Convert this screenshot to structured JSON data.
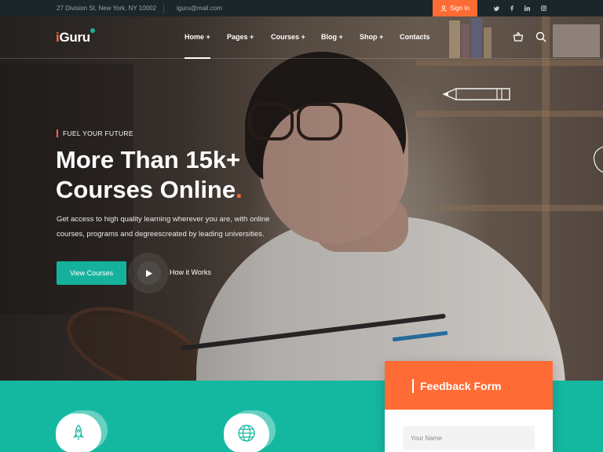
{
  "topbar": {
    "address": "27 Division St, New York, NY 10002",
    "email": "iguru@mail.com",
    "signin_label": "Sign In",
    "social": [
      "twitter-icon",
      "facebook-icon",
      "linkedin-icon",
      "instagram-icon"
    ]
  },
  "brand": {
    "logo_prefix": "i",
    "logo_rest": "Guru",
    "accent": "#ff6b35",
    "teal": "#14b8a0"
  },
  "nav": {
    "items": [
      "Home +",
      "Pages +",
      "Courses +",
      "Blog +",
      "Shop +",
      "Contacts"
    ],
    "active": "Home +",
    "icons": [
      "basket-icon",
      "search-icon"
    ]
  },
  "hero": {
    "eyebrow": "FUEL YOUR FUTURE",
    "headline_line1": "More Than 15k+",
    "headline_line2": "Courses Online",
    "headline_dot": ".",
    "subtext_line1": "Get access to high quality learning wherever you are, with online",
    "subtext_line2": "courses, programs and degreescreated by leading universities.",
    "cta_primary": "View Courses",
    "cta_secondary": "How it Works"
  },
  "features": {
    "icons": [
      "rocket-icon",
      "globe-icon"
    ]
  },
  "feedback": {
    "title": "Feedback Form",
    "name_placeholder": "Your Name"
  }
}
